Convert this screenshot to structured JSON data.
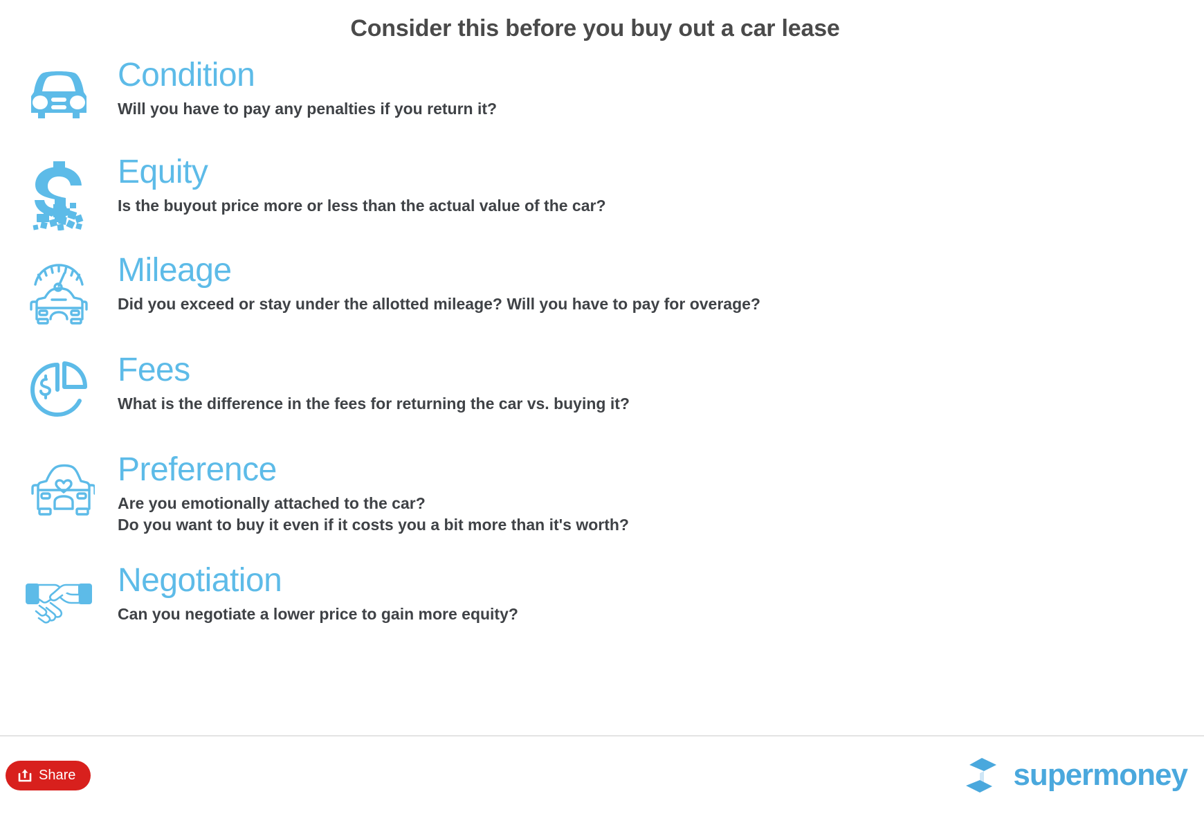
{
  "page": {
    "title": "Consider this before you buy out a car lease",
    "accent_color": "#5dbbe8",
    "text_color": "#3f4246",
    "share_button_color": "#d8201d",
    "background_color": "#ffffff"
  },
  "items": [
    {
      "icon": "car-front-icon",
      "heading": "Condition",
      "lines": [
        "Will you have to pay any penalties if you return it?"
      ]
    },
    {
      "icon": "dollar-sign-dissolving-icon",
      "heading": "Equity",
      "lines": [
        "Is the buyout price more or less than the actual value of the car?"
      ]
    },
    {
      "icon": "speedometer-car-icon",
      "heading": "Mileage",
      "lines": [
        "Did you exceed or stay under the allotted mileage? Will you have to pay for overage?"
      ]
    },
    {
      "icon": "pie-chart-dollar-icon",
      "heading": "Fees",
      "lines": [
        "What is the difference in the fees for returning the car vs. buying it?"
      ]
    },
    {
      "icon": "car-heart-icon",
      "heading": "Preference",
      "lines": [
        "Are you emotionally attached to the car?",
        "Do you want to buy it even if it costs you a bit more than it's worth?"
      ]
    },
    {
      "icon": "handshake-icon",
      "heading": "Negotiation",
      "lines": [
        "Can you negotiate a lower price to gain more equity?"
      ]
    }
  ],
  "footer": {
    "share_label": "Share",
    "share_icon": "share-export-icon",
    "logo_icon": "supermoney-cube-logo-icon",
    "logo_text": "supermoney"
  }
}
